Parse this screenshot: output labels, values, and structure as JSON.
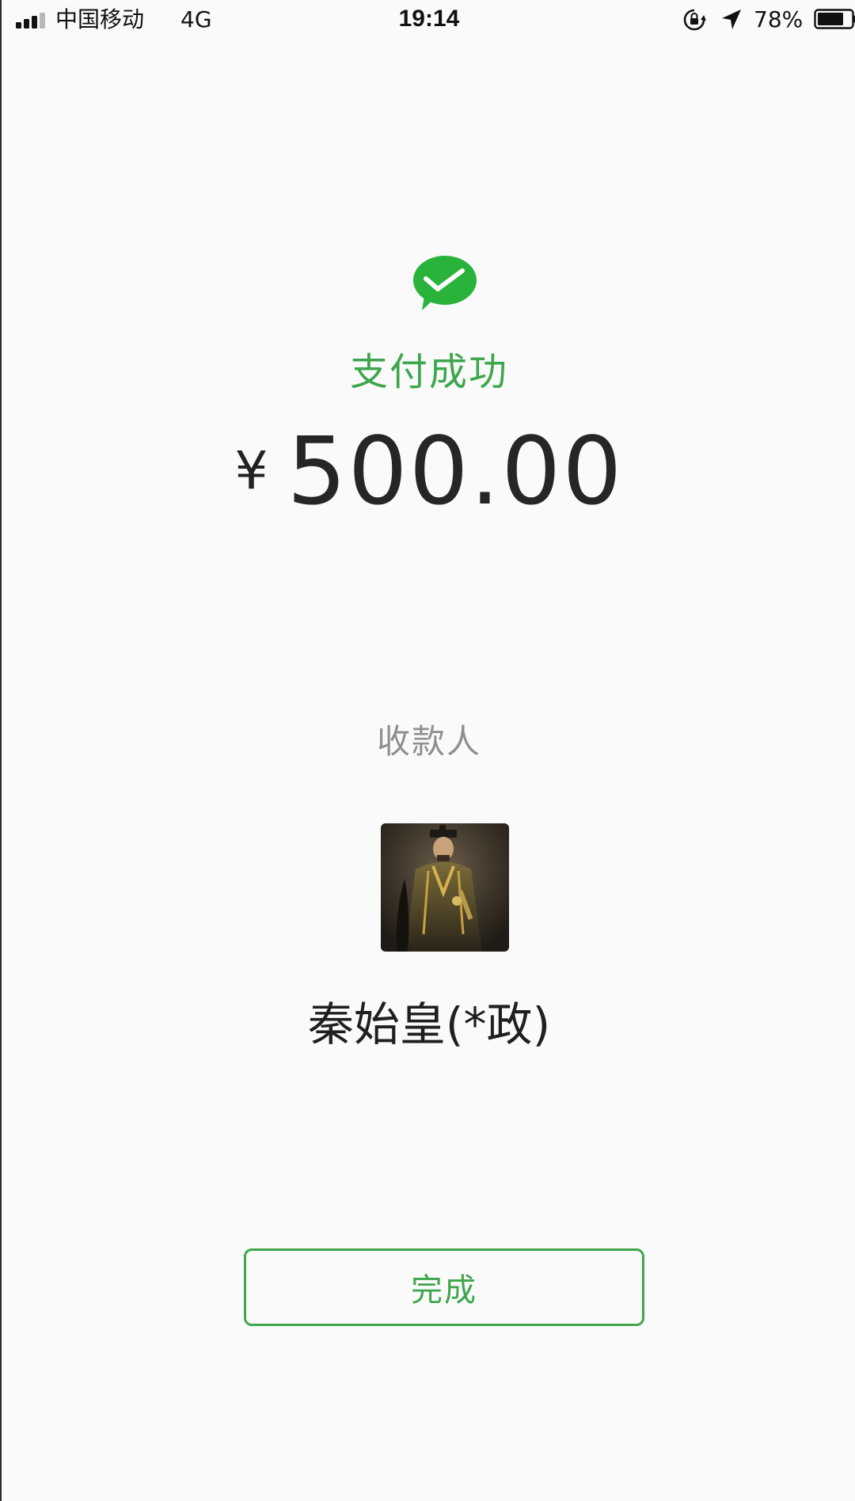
{
  "status_bar": {
    "carrier": "中国移动",
    "network": "4G",
    "time": "19:14",
    "battery_percent": "78%",
    "battery_level": 0.78,
    "icons": [
      "signal-icon",
      "rotation-lock-icon",
      "location-icon",
      "battery-icon"
    ]
  },
  "payment": {
    "status_icon": "wechat-pay-success-icon",
    "status_text": "支付成功",
    "currency_symbol": "¥",
    "amount": "500.00"
  },
  "payee": {
    "label": "收款人",
    "avatar": "payee-avatar",
    "name": "秦始皇(*政)"
  },
  "actions": {
    "done_label": "完成"
  },
  "colors": {
    "accent_green": "#3ea64c",
    "background": "#fafafa",
    "text_primary": "#262626",
    "text_secondary": "#8f8f8f"
  }
}
